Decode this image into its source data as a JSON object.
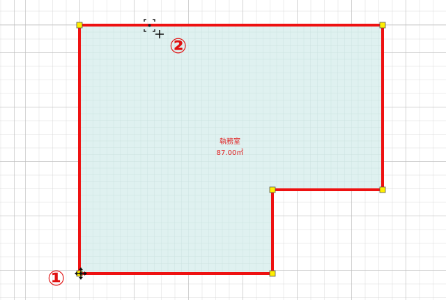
{
  "room": {
    "name": "執務室",
    "area": "87.00㎡"
  },
  "markers": {
    "start": "①",
    "next": "②"
  },
  "colors": {
    "wall": "#ee1111",
    "fill": "#dff1f0",
    "handle": "#ffee00",
    "label": "#e02020"
  },
  "icons": {
    "snap_cursor": "snap-crosshair-icon",
    "move_cursor": "move-arrows-icon"
  }
}
